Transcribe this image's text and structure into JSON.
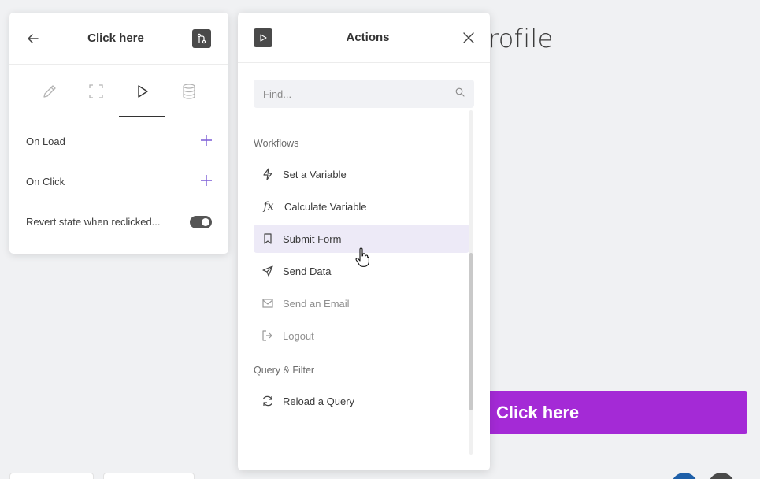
{
  "canvas": {
    "title_fragment": "rofile",
    "button_label": "Click here"
  },
  "left_panel": {
    "title": "Click here",
    "tabs": [
      "design-tab",
      "layout-tab",
      "actions-tab",
      "data-tab"
    ],
    "rows": [
      {
        "label": "On Load"
      },
      {
        "label": "On Click"
      },
      {
        "label": "Revert state when reclicked..."
      }
    ],
    "toggle_on": true
  },
  "actions_panel": {
    "title": "Actions",
    "search": {
      "placeholder": "Find...",
      "value": ""
    },
    "sections": [
      {
        "label": "Workflows",
        "items": [
          {
            "label": "Set a Variable",
            "icon": "lightning-icon"
          },
          {
            "label": "Calculate Variable",
            "icon": "function-icon"
          },
          {
            "label": "Submit Form",
            "icon": "bookmark-icon"
          },
          {
            "label": "Send Data",
            "icon": "send-icon"
          },
          {
            "label": "Send an Email",
            "icon": "mail-icon"
          },
          {
            "label": "Logout",
            "icon": "logout-icon"
          }
        ]
      },
      {
        "label": "Query & Filter",
        "items": [
          {
            "label": "Reload a Query",
            "icon": "refresh-icon"
          }
        ]
      }
    ]
  },
  "colors": {
    "accent": "#7c5cd6",
    "canvas_button": "#a42ad6",
    "hover_bg": "#edeaf7"
  }
}
